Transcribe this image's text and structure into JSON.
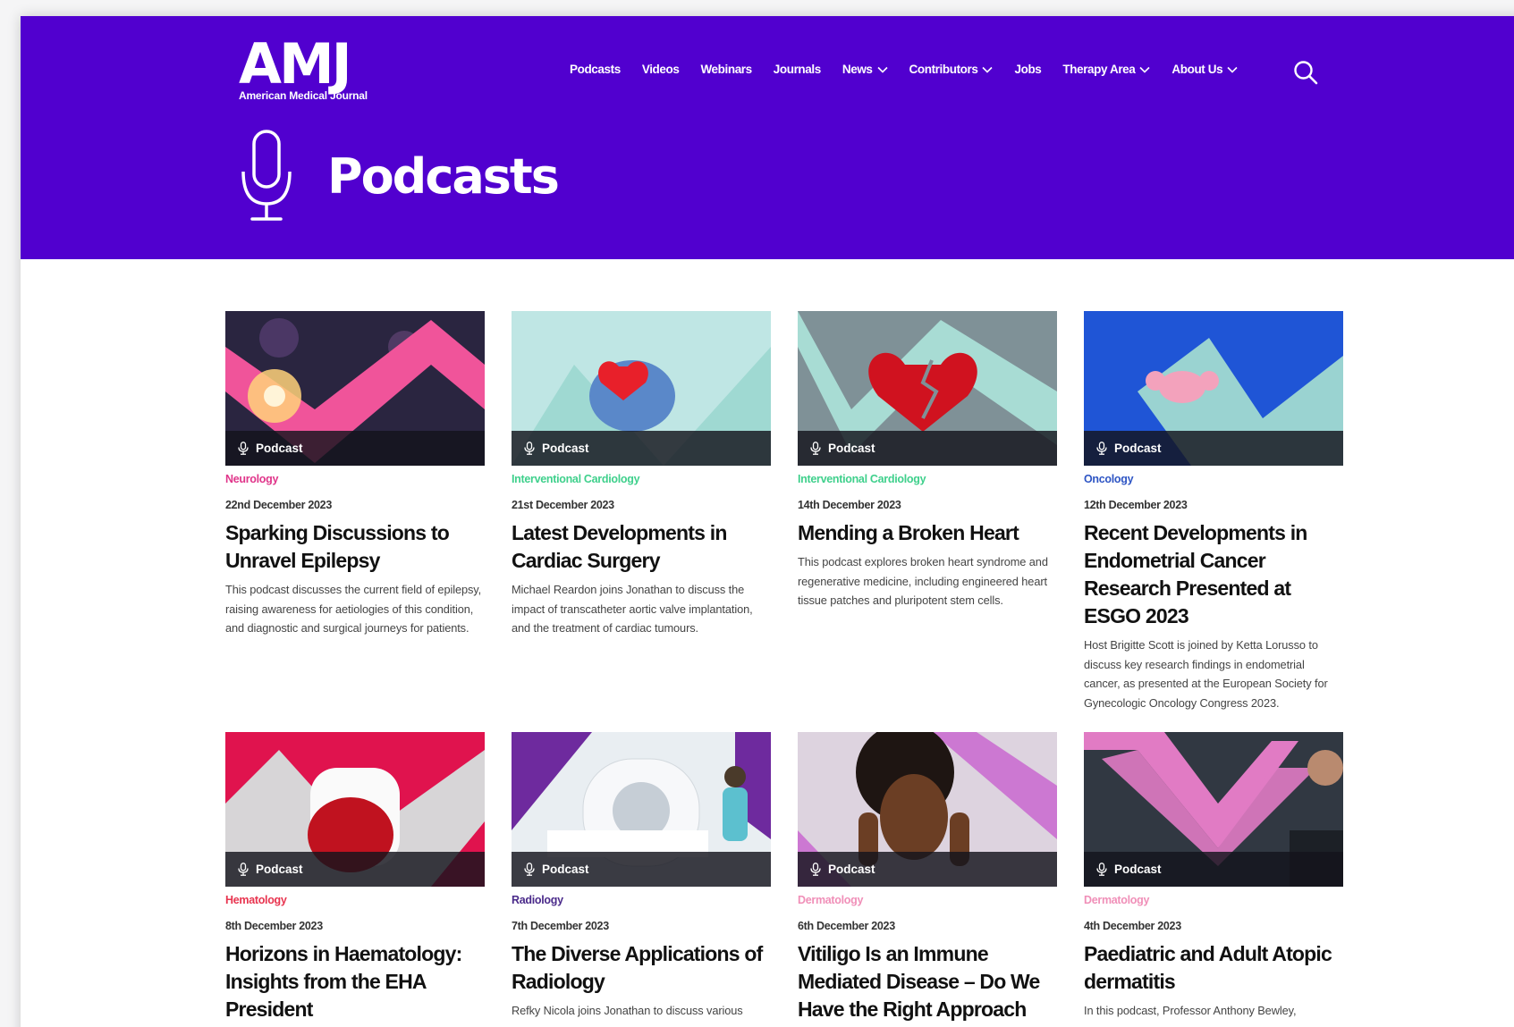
{
  "brand": {
    "mark": "AMJ",
    "name": "American Medical Journal"
  },
  "nav": [
    {
      "label": "Podcasts",
      "dropdown": false
    },
    {
      "label": "Videos",
      "dropdown": false
    },
    {
      "label": "Webinars",
      "dropdown": false
    },
    {
      "label": "Journals",
      "dropdown": false
    },
    {
      "label": "News",
      "dropdown": true
    },
    {
      "label": "Contributors",
      "dropdown": true
    },
    {
      "label": "Jobs",
      "dropdown": false
    },
    {
      "label": "Therapy Area",
      "dropdown": true
    },
    {
      "label": "About Us",
      "dropdown": true
    }
  ],
  "icons": {
    "search": "search-icon",
    "hero": "microphone-icon",
    "badge": "microphone-icon"
  },
  "page": {
    "title": "Podcasts"
  },
  "colors": {
    "brand": "#5100cf",
    "neurology": "#e0358a",
    "interventional_cardiology": "#3fd08c",
    "oncology": "#2e55c4",
    "hematology": "#e8344f",
    "radiology": "#4a2a8a",
    "dermatology": "#f08fb8"
  },
  "cards": [
    {
      "badge": "Podcast",
      "category": "Neurology",
      "category_color": "#e0358a",
      "date": "22nd December 2023",
      "title": "Sparking Discussions to Unravel Epilepsy",
      "description": "This podcast discusses the current field of epilepsy, raising awareness for aetiologies of this condition, and diagnostic and surgical journeys for patients."
    },
    {
      "badge": "Podcast",
      "category": "Interventional Cardiology",
      "category_color": "#3fd08c",
      "date": "21st December 2023",
      "title": "Latest Developments in Cardiac Surgery",
      "description": "Michael Reardon joins Jonathan to discuss the impact of transcatheter aortic valve implantation, and the treatment of cardiac tumours."
    },
    {
      "badge": "Podcast",
      "category": "Interventional Cardiology",
      "category_color": "#3fd08c",
      "date": "14th December 2023",
      "title": "Mending a Broken Heart",
      "description": "This podcast explores broken heart syndrome and regenerative medicine, including engineered heart tissue patches and pluripotent stem cells."
    },
    {
      "badge": "Podcast",
      "category": "Oncology",
      "category_color": "#2e55c4",
      "date": "12th December 2023",
      "title": "Recent Developments in Endometrial Cancer Research Presented at ESGO 2023",
      "description": "Host Brigitte Scott is joined by Ketta Lorusso to discuss key research findings in endometrial cancer, as presented at the European Society for Gynecologic Oncology Congress 2023."
    },
    {
      "badge": "Podcast",
      "category": "Hematology",
      "category_color": "#e8344f",
      "date": "8th December 2023",
      "title": "Horizons in Haematology: Insights from the EHA President",
      "description": ""
    },
    {
      "badge": "Podcast",
      "category": "Radiology",
      "category_color": "#4a2a8a",
      "date": "7th December 2023",
      "title": "The Diverse Applications of Radiology",
      "description": "Refky Nicola joins Jonathan to discuss various"
    },
    {
      "badge": "Podcast",
      "category": "Dermatology",
      "category_color": "#f08fb8",
      "date": "6th December 2023",
      "title": "Vitiligo Is an Immune Mediated Disease – Do We Have the Right Approach",
      "description": ""
    },
    {
      "badge": "Podcast",
      "category": "Dermatology",
      "category_color": "#f08fb8",
      "date": "4th December 2023",
      "title": "Paediatric and Adult Atopic dermatitis",
      "description": "In this podcast, Professor Anthony Bewley,"
    }
  ]
}
